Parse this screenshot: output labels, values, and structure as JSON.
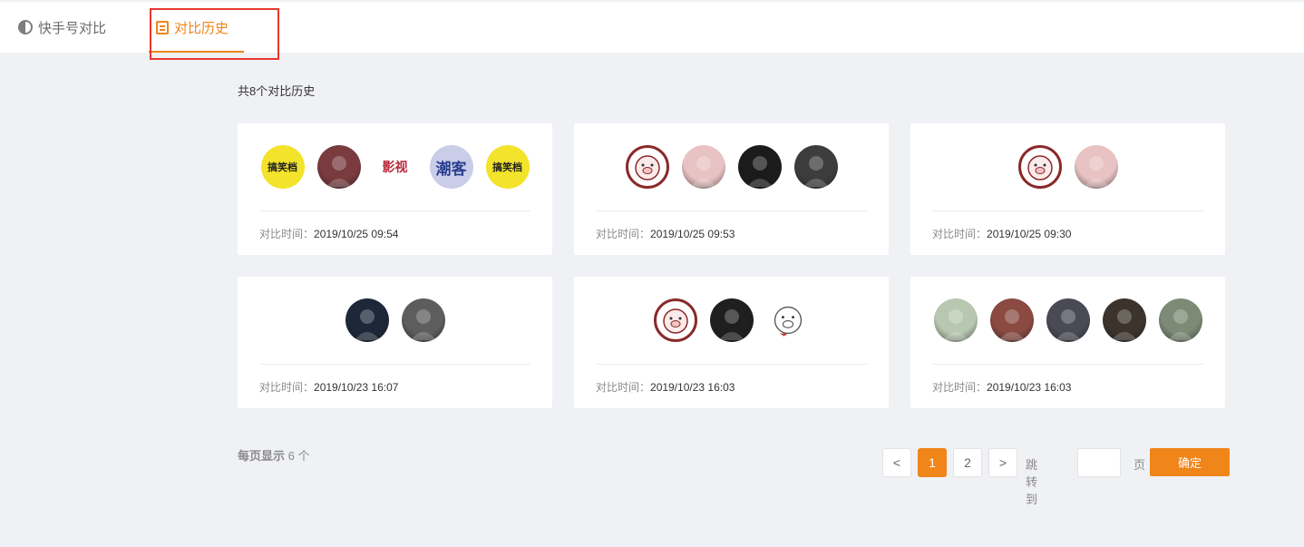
{
  "tabs": [
    {
      "label": "快手号对比",
      "icon": "half-circle-icon",
      "active": false
    },
    {
      "label": "对比历史",
      "icon": "document-icon",
      "active": true
    }
  ],
  "total_text": "共8个对比历史",
  "time_label": "对比时间：",
  "cards": [
    {
      "time": "2019/10/25 09:54",
      "avatars": [
        {
          "kind": "logo-yellow",
          "text": "搞笑档"
        },
        {
          "kind": "photo",
          "color": "#7a3b3f"
        },
        {
          "kind": "logo-text",
          "text": "影视"
        },
        {
          "kind": "logo-blue",
          "text": "潮客"
        },
        {
          "kind": "logo-yellow",
          "text": "搞笑档"
        }
      ]
    },
    {
      "time": "2019/10/25 09:53",
      "avatars": [
        {
          "kind": "pig"
        },
        {
          "kind": "photo",
          "color": "#e9c3c3"
        },
        {
          "kind": "photo",
          "color": "#1b1b1b"
        },
        {
          "kind": "photo",
          "color": "#3d3d3d"
        }
      ]
    },
    {
      "time": "2019/10/25 09:30",
      "avatars": [
        {
          "kind": "pig"
        },
        {
          "kind": "photo",
          "color": "#e9c3c3"
        }
      ]
    },
    {
      "time": "2019/10/23 16:07",
      "avatars": [
        {
          "kind": "photo",
          "color": "#1c2838"
        },
        {
          "kind": "photo",
          "color": "#5d5d5d"
        }
      ]
    },
    {
      "time": "2019/10/23 16:03",
      "avatars": [
        {
          "kind": "pig"
        },
        {
          "kind": "photo",
          "color": "#1f1f1f"
        },
        {
          "kind": "pig-plain"
        }
      ]
    },
    {
      "time": "2019/10/23 16:03",
      "avatars": [
        {
          "kind": "photo",
          "color": "#b8c8b0"
        },
        {
          "kind": "photo",
          "color": "#8a4a42"
        },
        {
          "kind": "photo",
          "color": "#4a4a55"
        },
        {
          "kind": "photo",
          "color": "#3b332c"
        },
        {
          "kind": "photo",
          "color": "#7d8a76"
        }
      ]
    }
  ],
  "pagination": {
    "per_page_label": "每页显示",
    "per_page_value": "6 个",
    "prev": "<",
    "next": ">",
    "pages": [
      "1",
      "2"
    ],
    "current_page": "1",
    "jump_label": "跳转到",
    "page_unit": "页",
    "confirm": "确定"
  },
  "colors": {
    "accent": "#f08519",
    "background": "#f0f1f5",
    "highlight": "#e8352f"
  }
}
